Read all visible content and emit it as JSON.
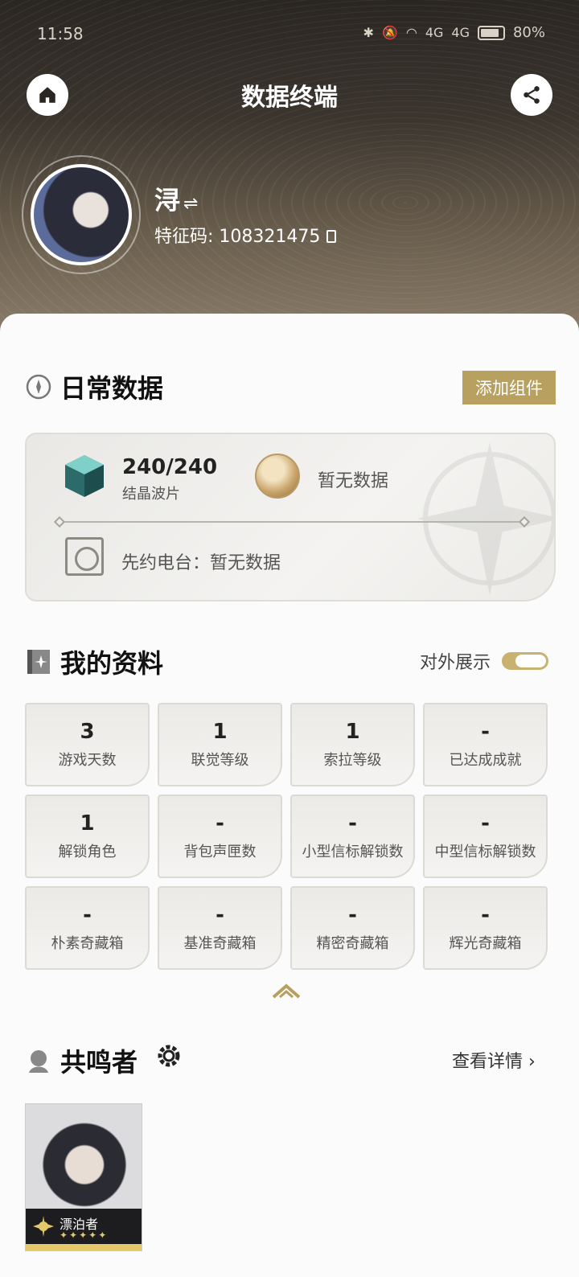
{
  "status_bar": {
    "time": "11:58",
    "battery": "80%",
    "signal_1": "4G",
    "signal_2": "4G"
  },
  "header": {
    "title": "数据终端"
  },
  "profile": {
    "name": "浔",
    "swap_glyph": "⇌",
    "code": "特征码: 108321475"
  },
  "daily": {
    "title": "日常数据",
    "add_button": "添加组件",
    "crystal_value": "240/240",
    "crystal_label": "结晶波片",
    "coin_label": "暂无数据",
    "radio_label": "先约电台：暂无数据"
  },
  "profile_section": {
    "title": "我的资料",
    "public_label": "对外展示",
    "public_on": true,
    "stats": [
      {
        "value": "3",
        "label": "游戏天数"
      },
      {
        "value": "1",
        "label": "联觉等级"
      },
      {
        "value": "1",
        "label": "索拉等级"
      },
      {
        "value": "-",
        "label": "已达成成就"
      },
      {
        "value": "1",
        "label": "解锁角色"
      },
      {
        "value": "-",
        "label": "背包声匣数"
      },
      {
        "value": "-",
        "label": "小型信标解锁数"
      },
      {
        "value": "-",
        "label": "中型信标解锁数"
      },
      {
        "value": "-",
        "label": "朴素奇藏箱"
      },
      {
        "value": "-",
        "label": "基准奇藏箱"
      },
      {
        "value": "-",
        "label": "精密奇藏箱"
      },
      {
        "value": "-",
        "label": "辉光奇藏箱"
      }
    ]
  },
  "resonators": {
    "title": "共鸣者",
    "detail_link": "查看详情 ›",
    "characters": [
      {
        "name": "漂泊者",
        "stars": "✦✦✦✦✦"
      }
    ]
  },
  "colors": {
    "accent_gold": "#b8a060",
    "toggle_gold": "#c9b26f",
    "star_gold": "#e4c86a"
  }
}
